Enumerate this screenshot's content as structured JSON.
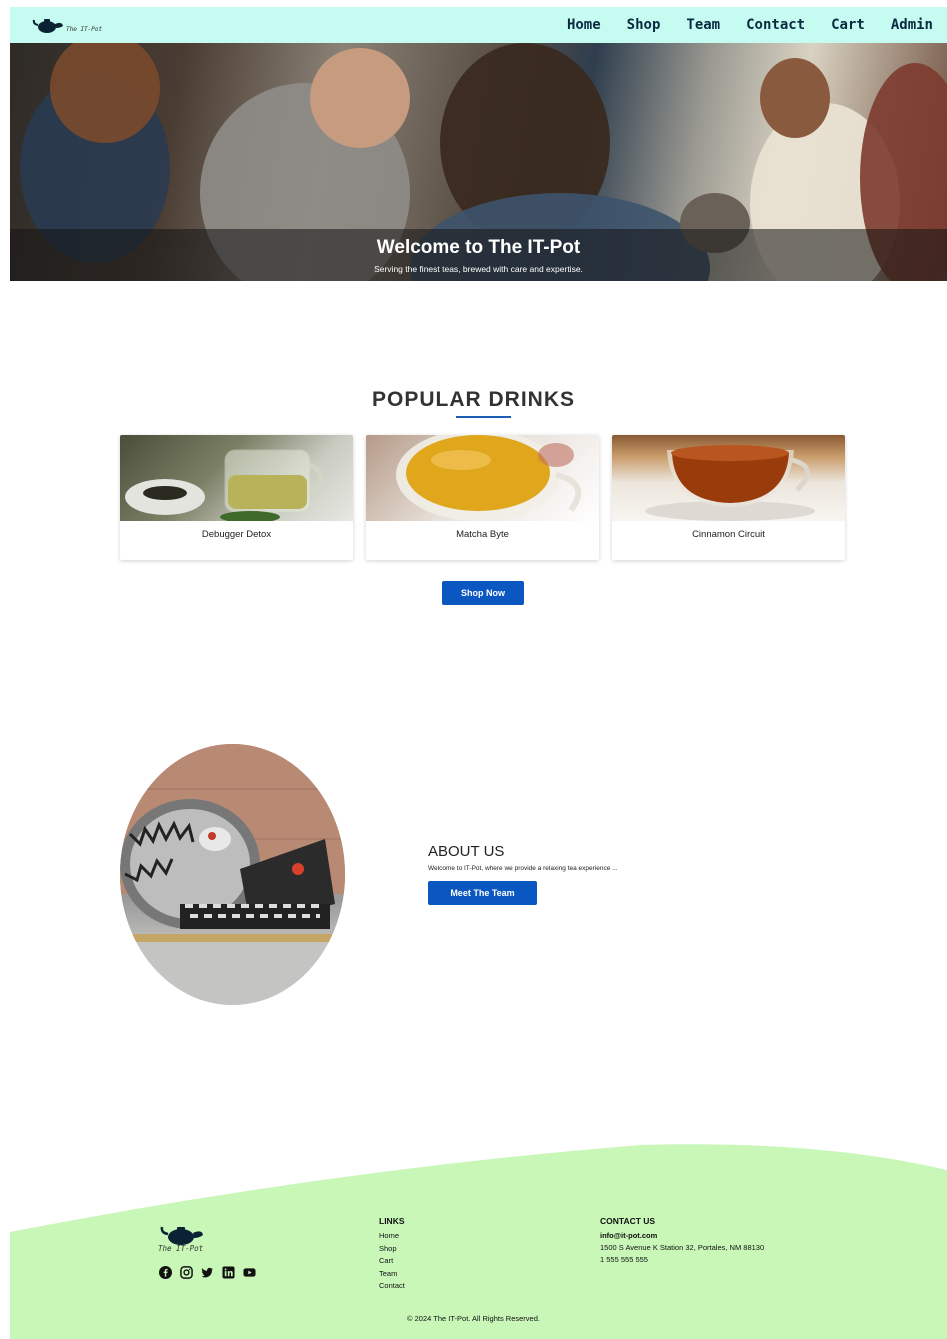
{
  "nav": {
    "logo_text": "The IT-Pot",
    "links": [
      "Home",
      "Shop",
      "Team",
      "Contact",
      "Cart",
      "Admin"
    ]
  },
  "hero": {
    "title": "Welcome to The IT-Pot",
    "subtitle": "Serving the finest teas, brewed with care and expertise."
  },
  "popular": {
    "title": "POPULAR DRINKS",
    "cards": [
      {
        "name": "Debugger Detox",
        "tea_color": "#b8b35a"
      },
      {
        "name": "Matcha Byte",
        "tea_color": "#e0a61c"
      },
      {
        "name": "Cinnamon Circuit",
        "tea_color": "#9a3b0c"
      }
    ],
    "button": "Shop Now"
  },
  "about": {
    "title": "ABOUT US",
    "text": "Welcome to IT-Pot, where we provide a relaxing tea experience ...",
    "button": "Meet The Team"
  },
  "footer": {
    "logo_text": "The IT-Pot",
    "socials": [
      "facebook-icon",
      "instagram-icon",
      "twitter-icon",
      "linkedin-icon",
      "youtube-icon"
    ],
    "links_title": "LINKS",
    "links": [
      "Home",
      "Shop",
      "Cart",
      "Team",
      "Contact"
    ],
    "contact_title": "CONTACT US",
    "email": "info@it-pot.com",
    "address": "1500 S Avenue K Station 32, Portales, NM 88130",
    "phone": "1 555 555 555",
    "copyright": "© 2024 The IT-Pot. All Rights Reserved.",
    "bg_color": "#c8f7b8"
  },
  "colors": {
    "nav_bg": "#c5fbf1",
    "accent": "#0b57c2"
  }
}
